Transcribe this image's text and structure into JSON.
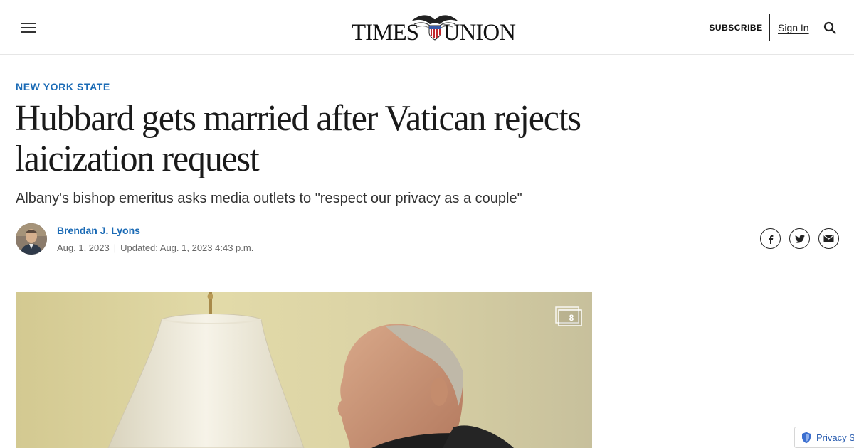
{
  "header": {
    "logo_left": "TIMES",
    "logo_right": "UNION",
    "subscribe_label": "SUBSCRIBE",
    "signin_label": "Sign In"
  },
  "article": {
    "section": "NEW YORK STATE",
    "headline": "Hubbard gets married after Vatican rejects laicization request",
    "subhead": "Albany's bishop emeritus asks media outlets to \"respect our privacy as a couple\"",
    "author": "Brendan J. Lyons",
    "published": "Aug. 1, 2023",
    "separator": "|",
    "updated": "Updated: Aug. 1, 2023 4:43 p.m."
  },
  "media": {
    "gallery_count": "8"
  },
  "privacy": {
    "label": "Privacy S"
  },
  "colors": {
    "accent": "#1a6ab5",
    "text": "#1a1a1a",
    "divider": "#9a9a9a"
  },
  "icons": [
    "menu-icon",
    "search-icon",
    "facebook-icon",
    "twitter-icon",
    "email-icon",
    "gallery-icon",
    "shield-icon"
  ]
}
